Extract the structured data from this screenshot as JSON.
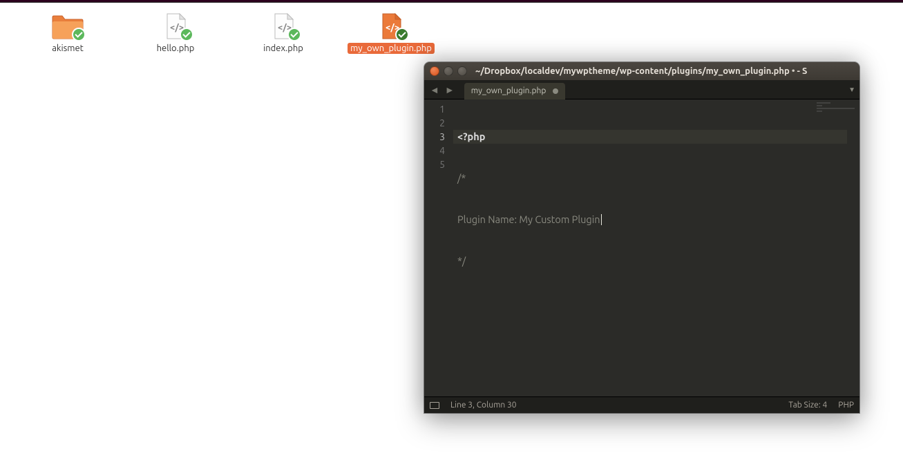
{
  "files": [
    {
      "name": "akismet",
      "type": "folder",
      "selected": false
    },
    {
      "name": "hello.php",
      "type": "php",
      "selected": false
    },
    {
      "name": "index.php",
      "type": "php",
      "selected": false
    },
    {
      "name": "my_own_plugin.php",
      "type": "php",
      "selected": true
    }
  ],
  "editor": {
    "title_path": "~/Dropbox/localdev/mywptheme/wp-content/plugins/my_own_plugin.php",
    "title_dirty_mark": "•",
    "title_app_hint": "- S",
    "tab_name": "my_own_plugin.php",
    "lines": {
      "num1": "1",
      "num2": "2",
      "num3": "3",
      "num4": "4",
      "num5": "5",
      "l1": "<?php",
      "l2": "/*",
      "l3": "Plugin Name: My Custom Plugin",
      "l4": "*/",
      "l5": ""
    },
    "status": {
      "position": "Line 3, Column 30",
      "tab_size": "Tab Size: 4",
      "syntax": "PHP"
    }
  }
}
